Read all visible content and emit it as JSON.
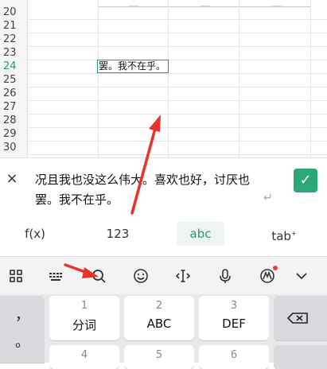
{
  "sheet": {
    "rows": [
      "20",
      "21",
      "22",
      "23",
      "24",
      "25",
      "26",
      "27",
      "28",
      "29",
      "30"
    ],
    "active_row": "24",
    "selected_cell_text": "罢。我不在乎。"
  },
  "formula_bar": {
    "text": "况且我也没这么伟大。喜欢也好，讨厌也罢。我不在乎。",
    "clear_icon": "×",
    "enter_icon": "↵",
    "confirm_icon": "✓"
  },
  "input_modes": [
    {
      "label": "f(x)",
      "active": false
    },
    {
      "label": "123",
      "active": false
    },
    {
      "label": "abc",
      "active": true
    },
    {
      "label": "tab",
      "active": false
    }
  ],
  "ime_toolbar": {
    "icons": [
      "grid-menu-icon",
      "keyboard-icon",
      "search-icon",
      "emoji-icon",
      "cursor-icon",
      "microphone-icon",
      "ai-icon",
      "collapse-chevron-icon"
    ]
  },
  "keyboard": {
    "left_symbols": [
      "，",
      "。"
    ],
    "keys": [
      {
        "num": "1",
        "label": "分词"
      },
      {
        "num": "2",
        "label": "ABC"
      },
      {
        "num": "3",
        "label": "DEF"
      },
      {
        "num": "4",
        "label": ""
      },
      {
        "num": "5",
        "label": ""
      },
      {
        "num": "6",
        "label": ""
      }
    ],
    "backspace_icon": "⌫"
  },
  "colors": {
    "accent": "#2aa876",
    "active_row": "#1f9e6e",
    "annotation": "#e8322b"
  }
}
